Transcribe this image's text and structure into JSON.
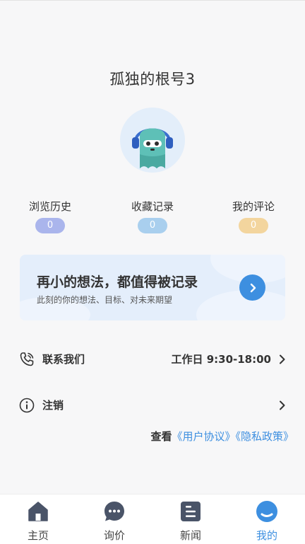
{
  "profile": {
    "username": "孤独的根号3",
    "avatar_icon": "headphone-monster-avatar-icon"
  },
  "stats": [
    {
      "label": "浏览历史",
      "count": "0",
      "color": "#aab5ec"
    },
    {
      "label": "收藏记录",
      "count": "0",
      "color": "#a9cfee"
    },
    {
      "label": "我的评论",
      "count": "0",
      "color": "#f3d59e"
    }
  ],
  "banner": {
    "title": "再小的想法，都值得被记录",
    "subtitle": "此刻的你的想法、目标、对未来期望",
    "accent": "#3d8fe0",
    "go_icon": "chevron-right-icon"
  },
  "contact": {
    "label": "联系我们",
    "hours": "工作日 9:30-18:00",
    "icon": "phone-icon"
  },
  "logout": {
    "label": "注销",
    "icon": "info-icon"
  },
  "agreements": {
    "prefix": "查看",
    "user_agreement": "《用户协议》",
    "privacy_policy": "《隐私政策》",
    "link_color": "#3d8fe0"
  },
  "tabbar": {
    "items": [
      {
        "label": "主页",
        "icon": "home-icon"
      },
      {
        "label": "询价",
        "icon": "chat-icon"
      },
      {
        "label": "新闻",
        "icon": "news-icon"
      },
      {
        "label": "我的",
        "icon": "profile-icon"
      }
    ],
    "active_label": "我的",
    "active_color": "#3d8fe0"
  }
}
